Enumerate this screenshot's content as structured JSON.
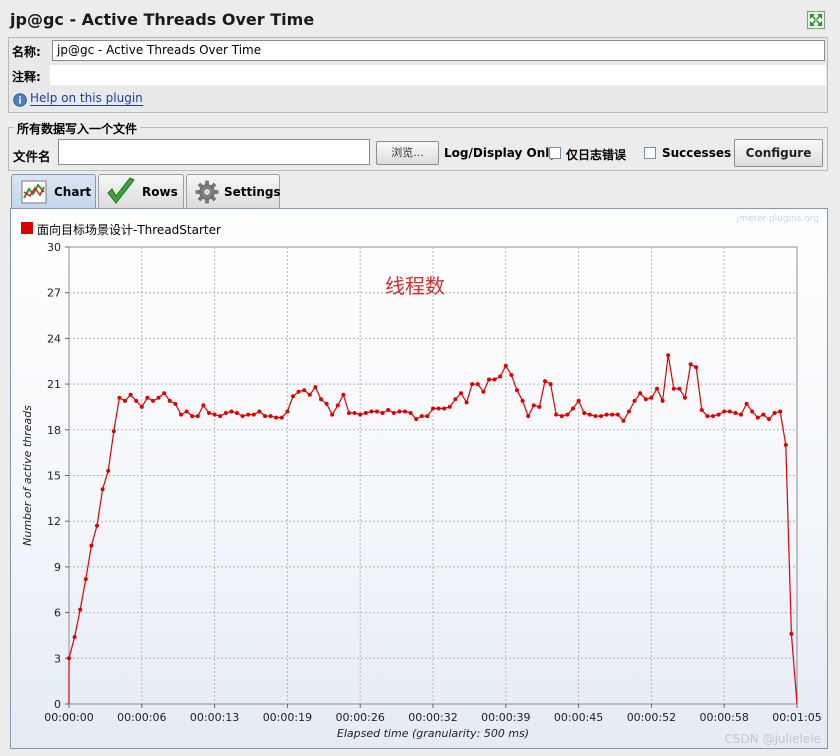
{
  "window": {
    "title": "jp@gc - Active Threads Over Time"
  },
  "form": {
    "name_label": "名称:",
    "name_value": "jp@gc - Active Threads Over Time",
    "comment_label": "注释:",
    "comment_value": "",
    "help_link": "Help on this plugin"
  },
  "file_section": {
    "legend": "所有数据写入一个文件",
    "filename_label": "文件名",
    "filename_value": "",
    "browse_label": "浏览...",
    "log_display_label": "Log/Display Only:",
    "errors_label": "仅日志错误",
    "errors_checked": false,
    "successes_label": "Successes",
    "successes_checked": false,
    "configure_label": "Configure"
  },
  "tabs": [
    {
      "label": "Chart",
      "icon": "chart-icon",
      "active": true
    },
    {
      "label": "Rows",
      "icon": "checkmark-icon",
      "active": false
    },
    {
      "label": "Settings",
      "icon": "gear-icon",
      "active": false
    }
  ],
  "watermark": "jmeter-plugins.org",
  "footer_watermark": "CSDN @julielele",
  "chart_data": {
    "type": "line",
    "title": "线程数",
    "xlabel": "Elapsed time (granularity: 500 ms)",
    "ylabel": "Number of active threads",
    "ylim": [
      0,
      30
    ],
    "yticks": [
      0,
      3,
      6,
      9,
      12,
      15,
      18,
      21,
      24,
      27,
      30
    ],
    "xlim_seconds": [
      0,
      65
    ],
    "xticks": [
      "00:00:00",
      "00:00:06",
      "00:00:13",
      "00:00:19",
      "00:00:26",
      "00:00:32",
      "00:00:39",
      "00:00:45",
      "00:00:52",
      "00:00:58",
      "00:01:05"
    ],
    "grid": true,
    "legend_position": "top-left",
    "series": [
      {
        "name": "面向目标场景设计-ThreadStarter",
        "color": "#e00000",
        "x": [
          0,
          0.5,
          1,
          1.5,
          2,
          2.5,
          3,
          3.5,
          4,
          4.5,
          5,
          5.5,
          6,
          6.5,
          7,
          7.5,
          8,
          8.5,
          9,
          9.5,
          10,
          10.5,
          11,
          11.5,
          12,
          12.5,
          13,
          13.5,
          14,
          14.5,
          15,
          15.5,
          16,
          16.5,
          17,
          17.5,
          18,
          18.5,
          19,
          19.5,
          20,
          20.5,
          21,
          21.5,
          22,
          22.5,
          23,
          23.5,
          24,
          24.5,
          25,
          25.5,
          26,
          26.5,
          27,
          27.5,
          28,
          28.5,
          29,
          29.5,
          30,
          30.5,
          31,
          31.5,
          32,
          32.5,
          33,
          33.5,
          34,
          34.5,
          35,
          35.5,
          36,
          36.5,
          37,
          37.5,
          38,
          38.5,
          39,
          39.5,
          40,
          40.5,
          41,
          41.5,
          42,
          42.5,
          43,
          43.5,
          44,
          44.5,
          45,
          45.5,
          46,
          46.5,
          47,
          47.5,
          48,
          48.5,
          49,
          49.5,
          50,
          50.5,
          51,
          51.5,
          52,
          52.5,
          53,
          53.5,
          54,
          54.5,
          55,
          55.5,
          56,
          56.5,
          57,
          57.5,
          58,
          58.5,
          59,
          59.5,
          60,
          60.5,
          61,
          61.5,
          62,
          62.5,
          63,
          63.5,
          64,
          64.5
        ],
        "values": [
          3.0,
          4.4,
          6.2,
          8.2,
          10.4,
          11.7,
          14.1,
          15.3,
          17.9,
          20.1,
          19.9,
          20.3,
          19.9,
          19.5,
          20.1,
          19.9,
          20.1,
          20.4,
          19.9,
          19.7,
          19.0,
          19.2,
          18.9,
          18.9,
          19.6,
          19.1,
          19.0,
          18.9,
          19.1,
          19.2,
          19.1,
          18.9,
          19.0,
          19.0,
          19.2,
          18.9,
          18.9,
          18.8,
          18.8,
          19.2,
          20.2,
          20.5,
          20.6,
          20.3,
          20.8,
          20.0,
          19.7,
          19.0,
          19.6,
          20.3,
          19.1,
          19.1,
          19.0,
          19.1,
          19.2,
          19.2,
          19.1,
          19.3,
          19.1,
          19.2,
          19.2,
          19.1,
          18.7,
          18.9,
          18.9,
          19.4,
          19.4,
          19.4,
          19.5,
          20.0,
          20.4,
          19.8,
          21.0,
          21.0,
          20.5,
          21.3,
          21.3,
          21.5,
          22.2,
          21.6,
          20.6,
          19.9,
          18.9,
          19.6,
          19.5,
          21.2,
          21.0,
          19.0,
          18.9,
          19.0,
          19.4,
          19.9,
          19.1,
          19.0,
          18.9,
          18.9,
          19.0,
          19.0,
          19.0,
          18.6,
          19.2,
          19.9,
          20.4,
          20.0,
          20.1,
          20.7,
          19.9,
          22.9,
          20.7,
          20.7,
          20.1,
          22.3,
          22.1,
          19.3,
          18.9,
          18.9,
          19.0,
          19.2,
          19.2,
          19.1,
          19.0,
          19.7,
          19.2,
          18.8,
          19.0,
          18.7,
          19.1,
          19.2,
          17.0,
          4.6
        ]
      }
    ]
  }
}
